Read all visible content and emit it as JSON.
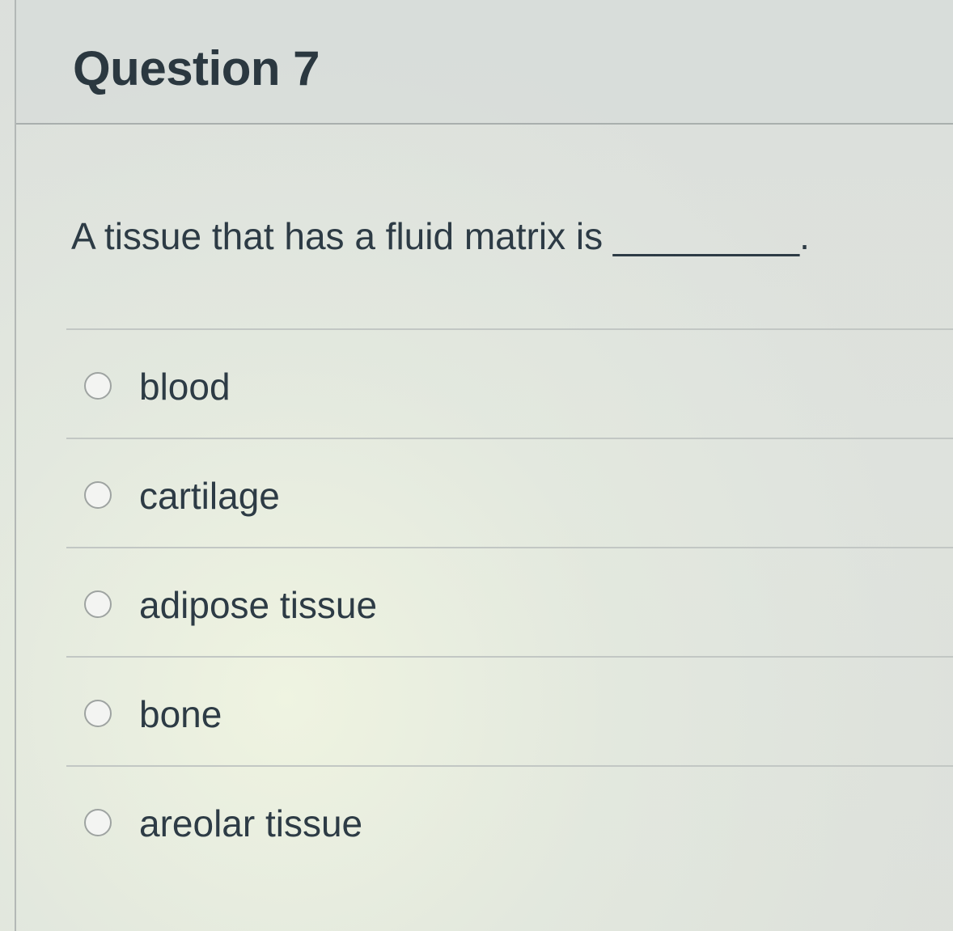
{
  "question": {
    "title": "Question 7",
    "text": "A tissue that has a fluid matrix is _________."
  },
  "answers": [
    {
      "label": "blood",
      "selected": false
    },
    {
      "label": "cartilage",
      "selected": false
    },
    {
      "label": "adipose tissue",
      "selected": false
    },
    {
      "label": "bone",
      "selected": false
    },
    {
      "label": "areolar tissue",
      "selected": false
    }
  ]
}
